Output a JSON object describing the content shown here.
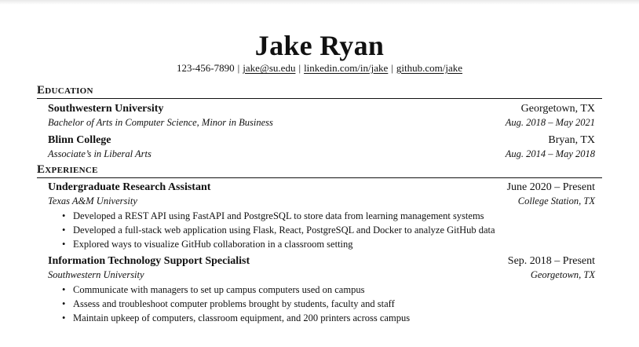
{
  "header": {
    "name": "Jake Ryan",
    "phone": "123-456-7890",
    "email": "jake@su.edu",
    "linkedin": "linkedin.com/in/jake",
    "github": "github.com/jake",
    "separator": "|"
  },
  "education": {
    "title": "Education",
    "entries": [
      {
        "school": "Southwestern University",
        "location": "Georgetown, TX",
        "degree": "Bachelor of Arts in Computer Science, Minor in Business",
        "dates": "Aug. 2018 – May 2021"
      },
      {
        "school": "Blinn College",
        "location": "Bryan, TX",
        "degree": "Associate’s in Liberal Arts",
        "dates": "Aug. 2014 – May 2018"
      }
    ]
  },
  "experience": {
    "title": "Experience",
    "entries": [
      {
        "role": "Undergraduate Research Assistant",
        "dates": "June 2020 – Present",
        "org": "Texas A&M University",
        "location": "College Station, TX",
        "bullets": [
          "Developed a REST API using FastAPI and PostgreSQL to store data from learning management systems",
          "Developed a full-stack web application using Flask, React, PostgreSQL and Docker to analyze GitHub data",
          "Explored ways to visualize GitHub collaboration in a classroom setting"
        ]
      },
      {
        "role": "Information Technology Support Specialist",
        "dates": "Sep. 2018 – Present",
        "org": "Southwestern University",
        "location": "Georgetown, TX",
        "bullets": [
          "Communicate with managers to set up campus computers used on campus",
          "Assess and troubleshoot computer problems brought by students, faculty and staff",
          "Maintain upkeep of computers, classroom equipment, and 200 printers across campus"
        ]
      }
    ]
  }
}
